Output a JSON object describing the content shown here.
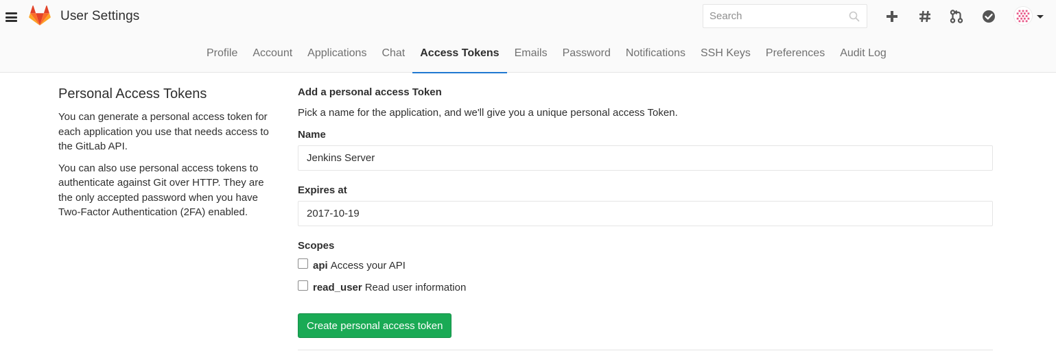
{
  "header": {
    "title": "User Settings",
    "search_placeholder": "Search",
    "icons": [
      "hamburger-icon",
      "gitlab-logo",
      "search-icon",
      "plus-icon",
      "hash-icon",
      "merge-request-icon",
      "todo-check-icon",
      "avatar",
      "caret-down-icon"
    ]
  },
  "subnav": {
    "tabs": [
      {
        "label": "Profile",
        "active": false
      },
      {
        "label": "Account",
        "active": false
      },
      {
        "label": "Applications",
        "active": false
      },
      {
        "label": "Chat",
        "active": false
      },
      {
        "label": "Access Tokens",
        "active": true
      },
      {
        "label": "Emails",
        "active": false
      },
      {
        "label": "Password",
        "active": false
      },
      {
        "label": "Notifications",
        "active": false
      },
      {
        "label": "SSH Keys",
        "active": false
      },
      {
        "label": "Preferences",
        "active": false
      },
      {
        "label": "Audit Log",
        "active": false
      }
    ]
  },
  "sidebar": {
    "title": "Personal Access Tokens",
    "paragraph1": "You can generate a personal access token for each application you use that needs access to the GitLab API.",
    "paragraph2": "You can also use personal access tokens to authenticate against Git over HTTP. They are the only accepted password when you have Two-Factor Authentication (2FA) enabled."
  },
  "form": {
    "heading": "Add a personal access Token",
    "description": "Pick a name for the application, and we'll give you a unique personal access Token.",
    "name_label": "Name",
    "name_value": "Jenkins Server",
    "expires_label": "Expires at",
    "expires_value": "2017-10-19",
    "scopes_label": "Scopes",
    "scopes": [
      {
        "name": "api",
        "description": "Access your API",
        "checked": false
      },
      {
        "name": "read_user",
        "description": "Read user information",
        "checked": false
      }
    ],
    "submit_label": "Create personal access token"
  },
  "colors": {
    "accent": "#1f78d1",
    "success": "#1aaa55",
    "logo_orange": "#fc6d26",
    "logo_dark": "#e24329",
    "logo_light": "#fca326"
  }
}
